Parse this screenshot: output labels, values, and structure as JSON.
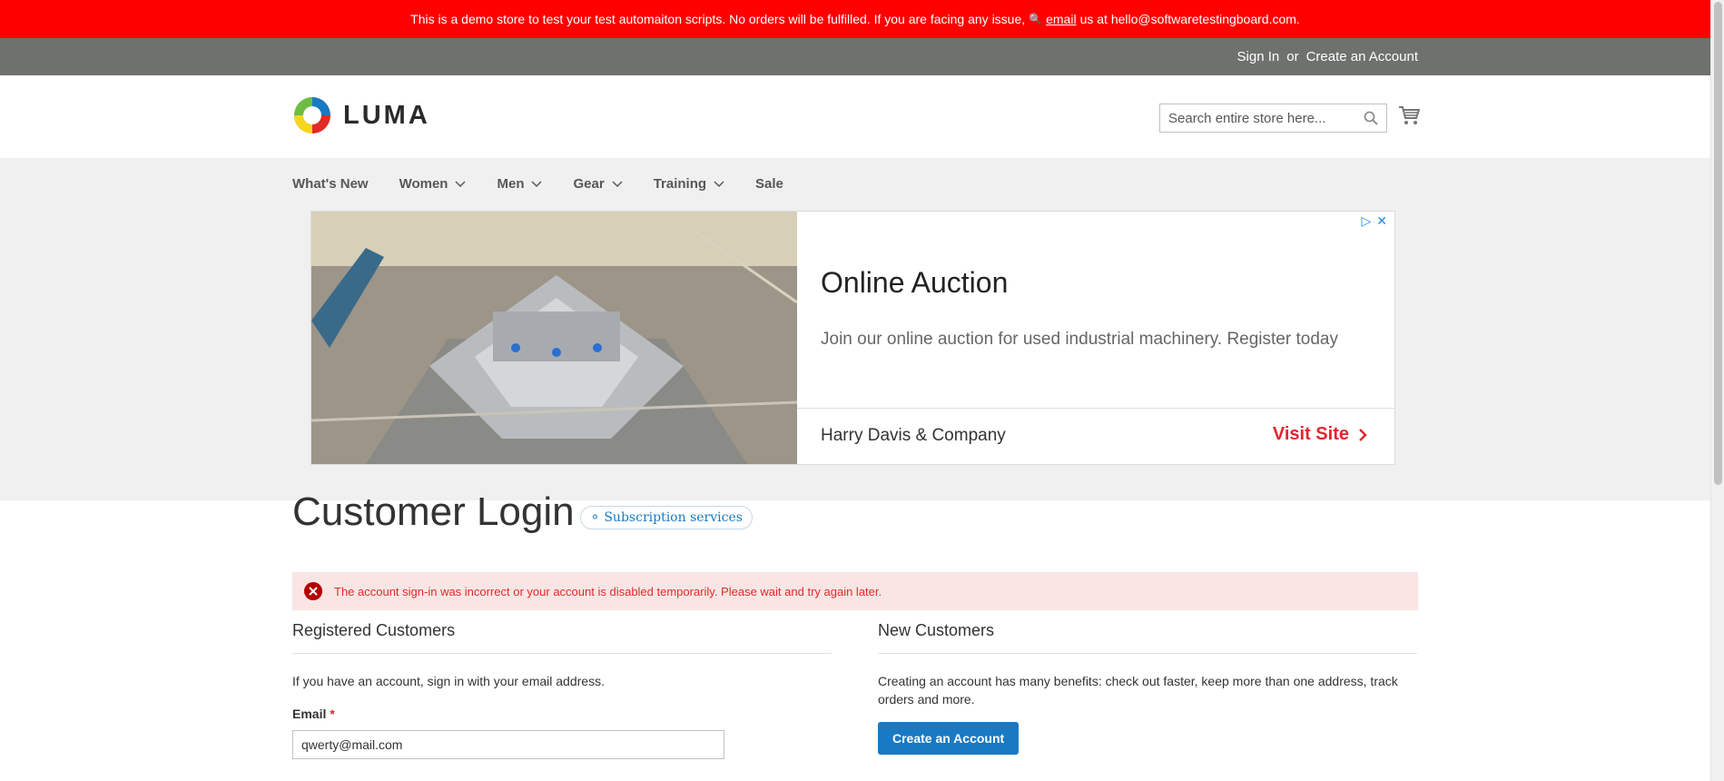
{
  "demo_notice": {
    "text": "This is a demo store to test your test automaiton scripts. No orders will be fulfilled. If you are facing any issue,",
    "link": "email",
    "suffix": "us at hello@softwaretestingboard.com."
  },
  "header": {
    "sign_in": "Sign In",
    "or": "or",
    "create_account": "Create an Account",
    "logo_text": "LUMA",
    "search_placeholder": "Search entire store here..."
  },
  "nav": {
    "items": [
      {
        "label": "What's New",
        "has_dropdown": false
      },
      {
        "label": "Women",
        "has_dropdown": true
      },
      {
        "label": "Men",
        "has_dropdown": true
      },
      {
        "label": "Gear",
        "has_dropdown": true
      },
      {
        "label": "Training",
        "has_dropdown": true
      },
      {
        "label": "Sale",
        "has_dropdown": false
      }
    ]
  },
  "ad": {
    "title": "Online Auction",
    "description": "Join our online auction for used industrial machinery. Register today",
    "company": "Harry Davis & Company",
    "cta": "Visit Site"
  },
  "page": {
    "title": "Customer Login",
    "badge": "Subscription services"
  },
  "error": {
    "message": "The account sign-in was incorrect or your account is disabled temporarily. Please wait and try again later."
  },
  "registered": {
    "heading": "Registered Customers",
    "intro": "If you have an account, sign in with your email address.",
    "email_label": "Email",
    "required_mark": "*",
    "email_value": "qwerty@mail.com"
  },
  "new_customers": {
    "heading": "New Customers",
    "intro": "Creating an account has many benefits: check out faster, keep more than one address, track orders and more.",
    "button": "Create an Account"
  },
  "colors": {
    "notice_bg": "#ff0000",
    "panel_bg": "#6e716e",
    "nav_bg": "#f0f0f0",
    "primary": "#1979c3",
    "error": "#e02b27",
    "error_bg": "#fae5e5",
    "ad_cta": "#e0262e"
  }
}
